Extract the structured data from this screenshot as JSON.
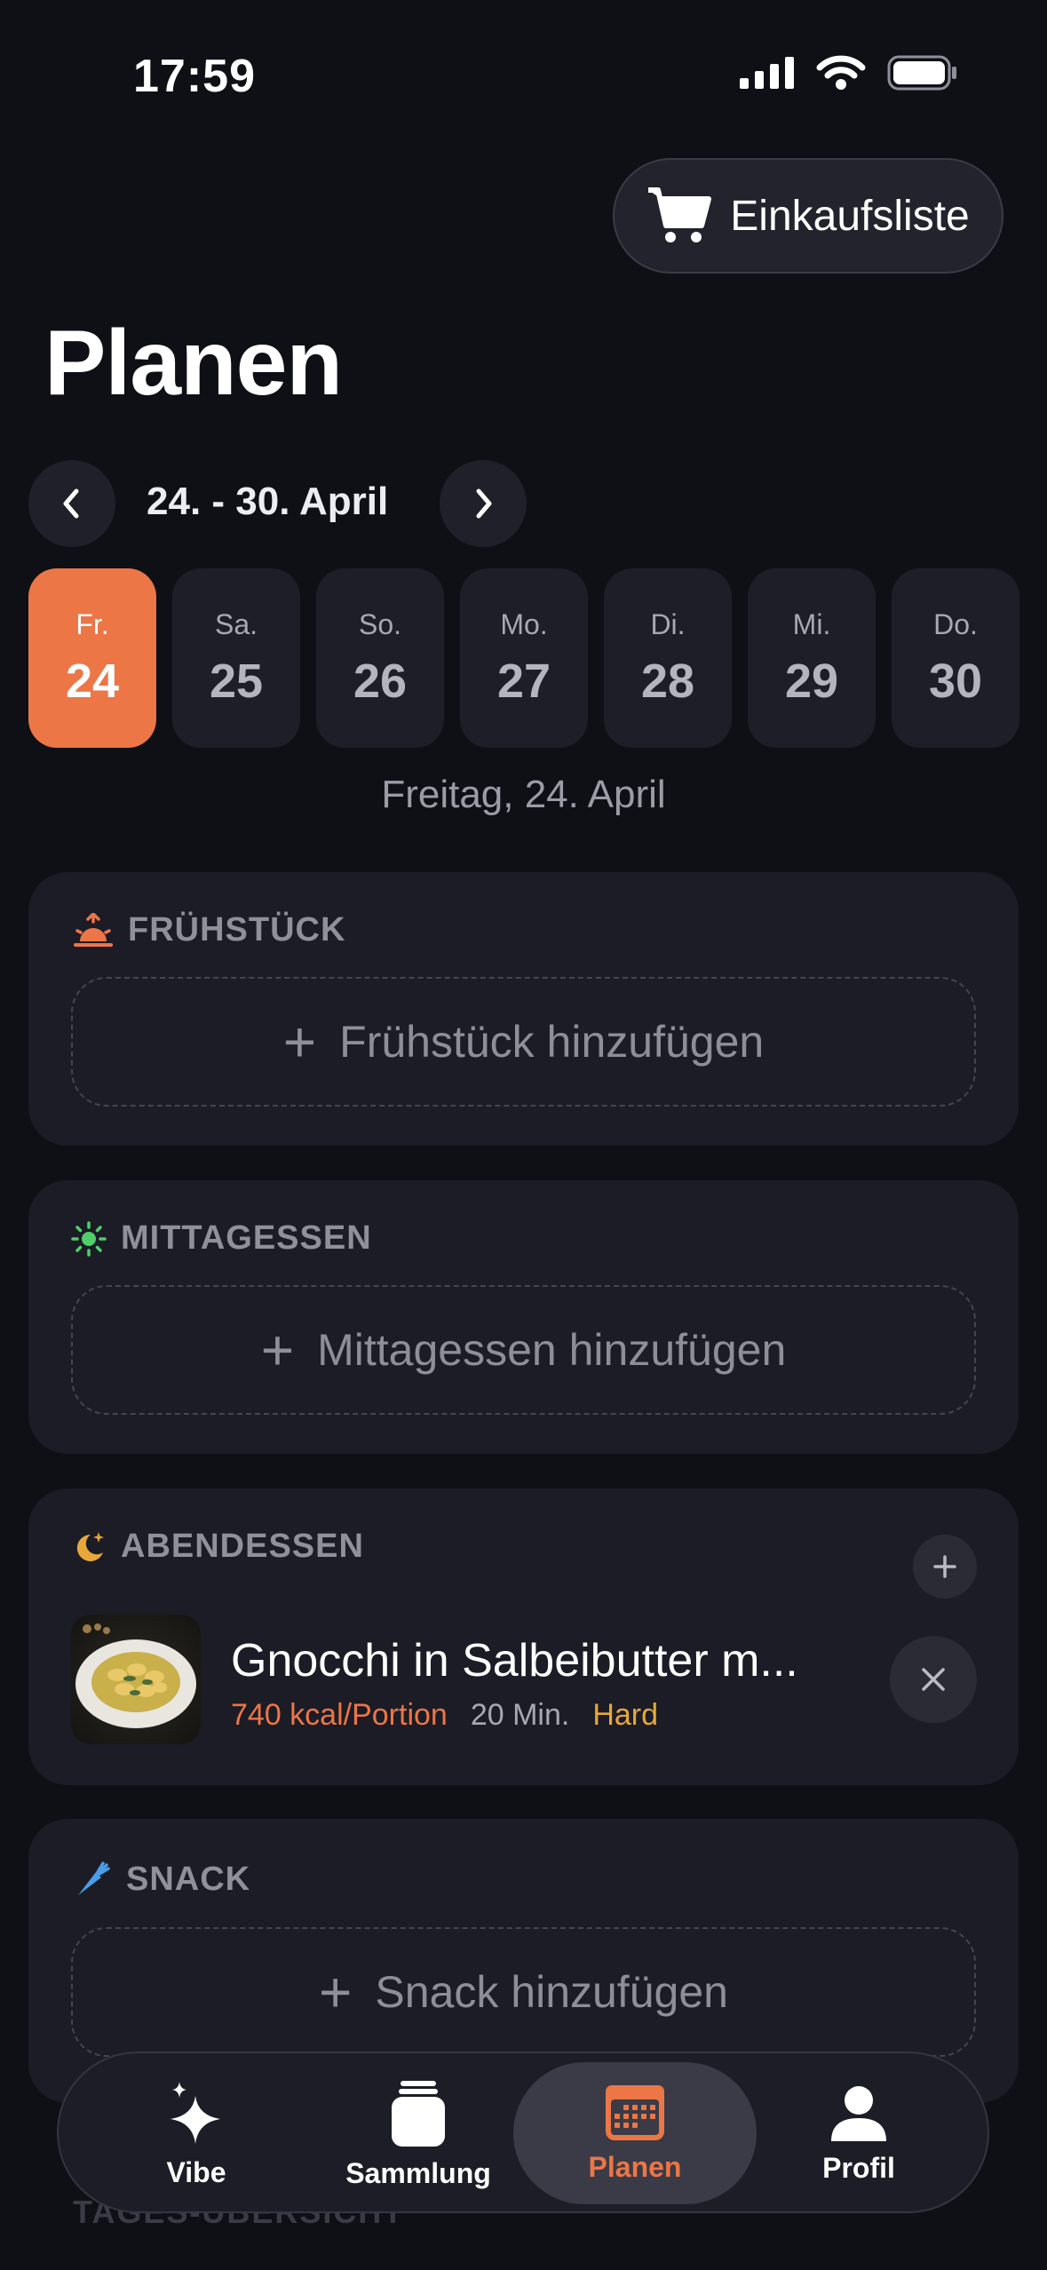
{
  "status": {
    "time": "17:59"
  },
  "header": {
    "shopping_list_label": "Einkaufsliste",
    "title": "Planen"
  },
  "week": {
    "range_label": "24. - 30. April",
    "days": [
      {
        "name": "Fr.",
        "num": "24"
      },
      {
        "name": "Sa.",
        "num": "25"
      },
      {
        "name": "So.",
        "num": "26"
      },
      {
        "name": "Mo.",
        "num": "27"
      },
      {
        "name": "Di.",
        "num": "28"
      },
      {
        "name": "Mi.",
        "num": "29"
      },
      {
        "name": "Do.",
        "num": "30"
      }
    ],
    "selected_caption": "Freitag, 24. April"
  },
  "meals": {
    "breakfast": {
      "title": "FRÜHSTÜCK",
      "add_label": "Frühstück hinzufügen"
    },
    "lunch": {
      "title": "MITTAGESSEN",
      "add_label": "Mittagessen hinzufügen"
    },
    "dinner": {
      "title": "ABENDESSEN",
      "recipe": {
        "title": "Gnocchi in Salbeibutter m...",
        "kcal": "740 kcal/Portion",
        "time": "20 Min.",
        "difficulty": "Hard"
      }
    },
    "snack": {
      "title": "SNACK",
      "add_label": "Snack hinzufügen"
    }
  },
  "daily_overview_label": "TAGES-ÜBERSICHT",
  "tabbar": {
    "tabs": [
      {
        "label": "Vibe"
      },
      {
        "label": "Sammlung"
      },
      {
        "label": "Planen"
      },
      {
        "label": "Profil"
      }
    ]
  },
  "colors": {
    "accent": "#ec7646",
    "background": "#0f1016",
    "card": "#1b1c25",
    "difficulty": "#e7a83a"
  }
}
